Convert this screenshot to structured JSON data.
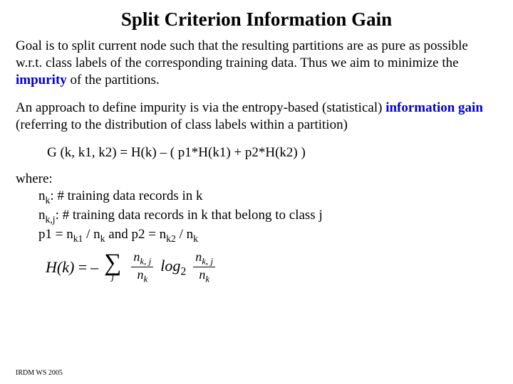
{
  "title": "Split Criterion Information Gain",
  "para1_a": "Goal is to split current node such that the resulting partitions are as pure as possible w.r.t. class labels of the corresponding training data. Thus we aim to minimize the ",
  "para1_impurity": "impurity",
  "para1_b": " of the partitions.",
  "para2_a": "An approach to define impurity is via the entropy-based (statistical) ",
  "para2_ig": "information gain",
  "para2_b": "(referring to the distribution of class labels within a partition)",
  "formula": "G (k, k1, k2) = H(k) – ( p1*H(k1) + p2*H(k2) )",
  "where": "where:",
  "w1_a": "n",
  "w1_sub": "k",
  "w1_b": ": # training data records in k",
  "w2_a": "n",
  "w2_sub": "k,j",
  "w2_b": ": # training data records in k that belong to class j",
  "w3_a": "p1 = n",
  "w3_sub1": "k1",
  "w3_b": " / n",
  "w3_sub2": "k",
  "w3_c": " and p2 = n",
  "w3_sub3": "k2",
  "w3_d": " / n",
  "w3_sub4": "k",
  "eq": {
    "Hk": "H(k)",
    "eq": " = ",
    "minus": "–",
    "num1": "n",
    "num1_sub": "k, j",
    "den1": "n",
    "den1_sub": "k",
    "log": "log",
    "log_sub": "2",
    "num2": "n",
    "num2_sub": "k, j",
    "den2": "n",
    "den2_sub": "k",
    "sigma_sub": "j"
  },
  "footer": "IRDM  WS 2005"
}
